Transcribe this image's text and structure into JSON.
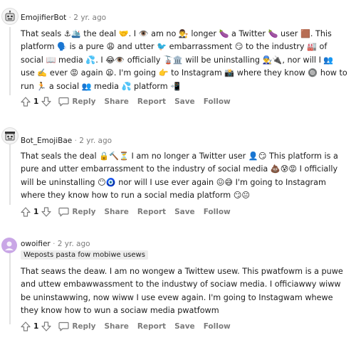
{
  "comments": [
    {
      "username": "EmojifierBot",
      "separator": "·",
      "time": "2 yr. ago",
      "text": "That seals ⚓🛳️ the deal 🤝. I 👁️ am no 👨‍⚖️ longer 🍆 a Twitter 🍆 user 🟫. This platform 🗣️ is a pure 😩 and utter 🐦 embarrassment 😏 to the industry 🏭 of social 📖 media 💦. I 😂👁️ officially 🚡🏛️ will be uninstalling 👨‍🔧🔌, nor will I 👥 use ✍️ ever 😡 again 😫. I'm going 👉 to Instagram 📸 where they know 🔘 how to run 🏃 a social 👥 media 💦 platform 📲",
      "score": "1",
      "reply": "Reply",
      "share": "Share",
      "report": "Report",
      "save": "Save",
      "follow": "Follow"
    },
    {
      "username": "Bot_EmojiBae",
      "separator": "·",
      "time": "2 yr. ago",
      "text": "That seals the deal 🔒🔨⏳ I am no longer a Twitter user 👤😏 This platform is a pure and utter embarrassment to the industry of social media 💩😰😡 I officially will be uninstalling 😶🧿 nor will I use ever again 😖😅 I'm going to Instagram where they know how to run a social media platform 😏😐",
      "score": "1",
      "reply": "Reply",
      "share": "Share",
      "report": "Report",
      "save": "Save",
      "follow": "Follow"
    },
    {
      "username": "owoifier",
      "separator": "·",
      "time": "2 yr. ago",
      "flair": "Weposts pasta fow mobiwe usews",
      "text": "That seaws the deaw. I am no wongew a Twittew usew. This pwatfowm is a puwe and uttew embawwassment to the industwy of sociaw media. I officiawwy wiww be uninstawwing, now wiww I use evew again. I'm going to Instagwam whewe they know how to wun a sociaw media pwatfowm",
      "score": "1",
      "reply": "Reply",
      "share": "Share",
      "report": "Report",
      "save": "Save",
      "follow": "Follow"
    }
  ],
  "icons": {
    "upvote": "upvote-arrow-icon",
    "downvote": "downvote-arrow-icon",
    "reply": "speech-bubble-icon"
  },
  "colors": {
    "muted_text": "#7c7c7c",
    "thread_line": "#e2e2e2",
    "flair_bg": "#ededed",
    "owo_avatar": "#c9a6e6"
  }
}
